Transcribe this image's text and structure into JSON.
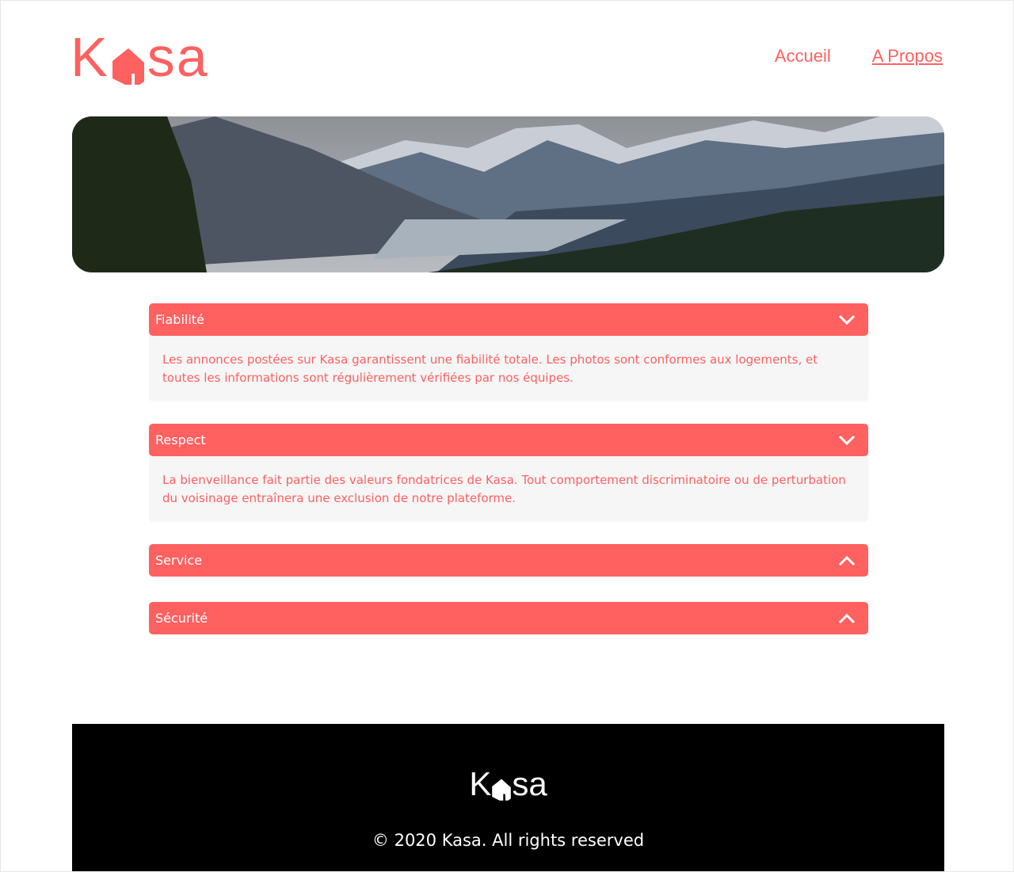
{
  "header": {
    "logo_alt": "Kasa",
    "nav": [
      {
        "label": "Accueil"
      },
      {
        "label": "A Propos"
      }
    ]
  },
  "banner": {
    "image": "mountain-landscape"
  },
  "accordions": [
    {
      "title": "Fiabilité",
      "open": true,
      "text": "Les annonces postées sur Kasa garantissent une fiabilité totale. Les photos sont conformes aux logements, et toutes les informations sont régulièrement vérifiées par nos équipes."
    },
    {
      "title": "Respect",
      "open": true,
      "text": "La bienveillance fait partie des valeurs fondatrices de Kasa. Tout comportement discriminatoire ou de perturbation du voisinage entraînera une exclusion de notre plateforme."
    },
    {
      "title": "Service",
      "open": false
    },
    {
      "title": "Sécurité",
      "open": false
    }
  ],
  "footer": {
    "logo_alt": "Kasa",
    "copyright": "© 2020 Kasa. All rights reserved"
  },
  "colors": {
    "accent": "#FF6060",
    "panel": "#F6F6F6",
    "footer": "#000000"
  }
}
